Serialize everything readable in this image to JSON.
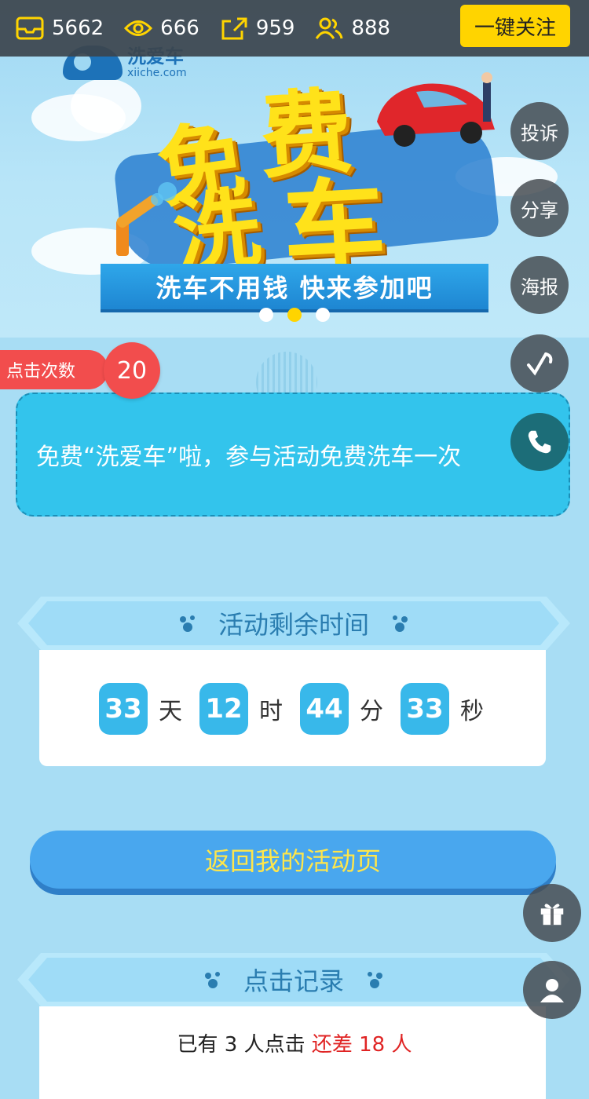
{
  "stats": {
    "items": [
      {
        "icon": "inbox-icon",
        "value": "5662"
      },
      {
        "icon": "eye-icon",
        "value": "666"
      },
      {
        "icon": "share-out-icon",
        "value": "959"
      },
      {
        "icon": "users-icon",
        "value": "888"
      }
    ],
    "follow_label": "一键关注"
  },
  "banner": {
    "logo_cn": "洗爱车",
    "logo_en": "xiiche.com",
    "title_chars": [
      "免",
      "费",
      "洗",
      "车"
    ],
    "slogan": "洗车不用钱 快来参加吧",
    "carousel": {
      "count": 3,
      "active": 2
    }
  },
  "side": {
    "complain": "投诉",
    "share": "分享",
    "poster": "海报"
  },
  "click_count": {
    "label": "点击次数",
    "value": "20"
  },
  "intro": "免费“洗爱车”啦，参与活动免费洗车一次",
  "countdown": {
    "title": "活动剩余时间",
    "days": "33",
    "days_unit": "天",
    "hours": "12",
    "hours_unit": "时",
    "minutes": "44",
    "minutes_unit": "分",
    "seconds": "33",
    "seconds_unit": "秒"
  },
  "return_button": "返回我的活动页",
  "records": {
    "title": "点击记录",
    "prefix": "已有 3 人点击",
    "remaining": "还差 18 人"
  },
  "colors": {
    "accent": "#ffd400",
    "primary_blue": "#49a7ee",
    "badge_red": "#f24d4d",
    "intro_bg": "#33c4ec"
  }
}
